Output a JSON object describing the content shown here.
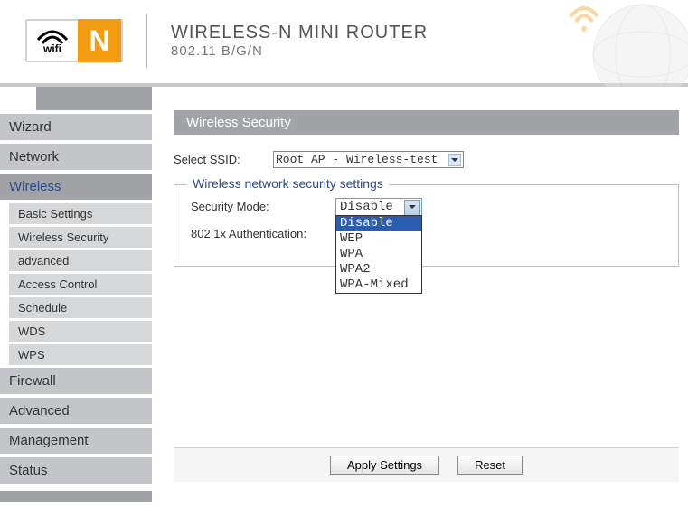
{
  "header": {
    "logo_wifi": "wifi",
    "logo_n": "N",
    "title": "WIRELESS-N MINI ROUTER",
    "subtitle": "802.11 B/G/N"
  },
  "sidebar": {
    "items": [
      {
        "label": "Wizard",
        "active": false
      },
      {
        "label": "Network",
        "active": false
      },
      {
        "label": "Wireless",
        "active": true,
        "children": [
          "Basic Settings",
          "Wireless Security",
          "advanced",
          "Access Control",
          "Schedule",
          "WDS",
          "WPS"
        ]
      },
      {
        "label": "Firewall",
        "active": false
      },
      {
        "label": "Advanced",
        "active": false
      },
      {
        "label": "Management",
        "active": false
      },
      {
        "label": "Status",
        "active": false
      }
    ]
  },
  "page": {
    "title": "Wireless Security",
    "ssid_label": "Select SSID:",
    "ssid_value": "Root AP - Wireless-test",
    "fieldset_legend": "Wireless network security settings",
    "security_mode_label": "Security Mode:",
    "security_mode_value": "Disable",
    "security_mode_options": [
      "Disable",
      "WEP",
      "WPA",
      "WPA2",
      "WPA-Mixed"
    ],
    "auth_label": "802.1x Authentication:"
  },
  "buttons": {
    "apply": "Apply Settings",
    "reset": "Reset"
  }
}
